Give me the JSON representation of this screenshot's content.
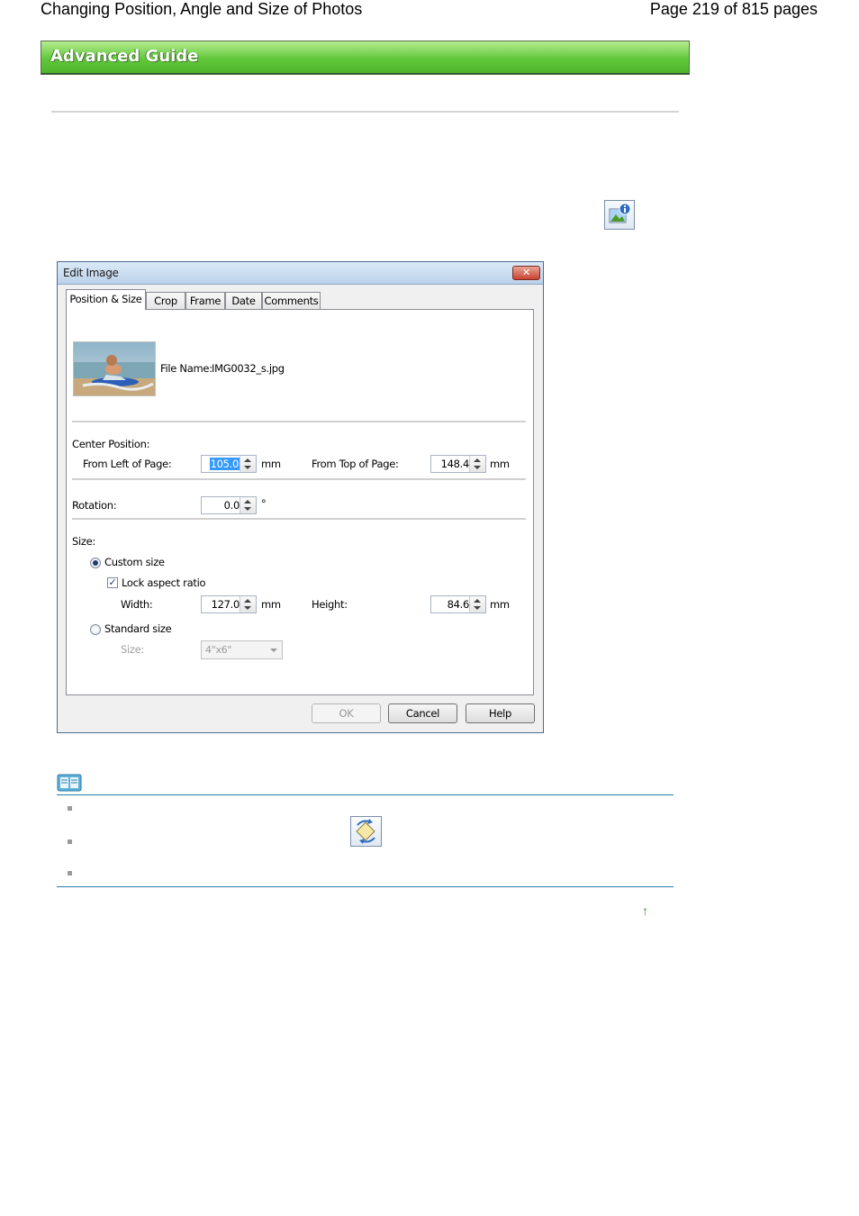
{
  "header": {
    "title": "Changing Position, Angle and Size of Photos",
    "page_indicator": "Page 219 of 815 pages"
  },
  "banner": {
    "label": "Advanced Guide"
  },
  "dialog": {
    "title": "Edit Image",
    "close_glyph": "✕",
    "tabs": [
      "Position & Size",
      "Crop",
      "Frame",
      "Date",
      "Comments"
    ],
    "active_tab": "Position & Size",
    "file_name_label": "File Name:",
    "file_name_value": "IMG0032_s.jpg",
    "center_position_label": "Center Position:",
    "from_left_label": "From Left of Page:",
    "from_left_value": "105.0",
    "from_left_unit": "mm",
    "from_top_label": "From Top of Page:",
    "from_top_value": "148.4",
    "from_top_unit": "mm",
    "rotation_label": "Rotation:",
    "rotation_value": "0.0",
    "rotation_unit": "°",
    "size_label": "Size:",
    "custom_size_label": "Custom size",
    "custom_size_selected": true,
    "lock_aspect_label": "Lock aspect ratio",
    "lock_aspect_checked": true,
    "width_label": "Width:",
    "width_value": "127.0",
    "width_unit": "mm",
    "height_label": "Height:",
    "height_value": "84.6",
    "height_unit": "mm",
    "standard_size_label": "Standard size",
    "standard_size_selected": false,
    "standard_size_sublabel": "Size:",
    "standard_size_value": "4\"x6\"",
    "buttons": {
      "ok": "OK",
      "cancel": "Cancel",
      "help": "Help"
    }
  },
  "notes": {
    "return_to_top_glyph": "↑"
  },
  "colors": {
    "banner_green": "#62c83b",
    "note_rule": "#2a7ca8"
  }
}
